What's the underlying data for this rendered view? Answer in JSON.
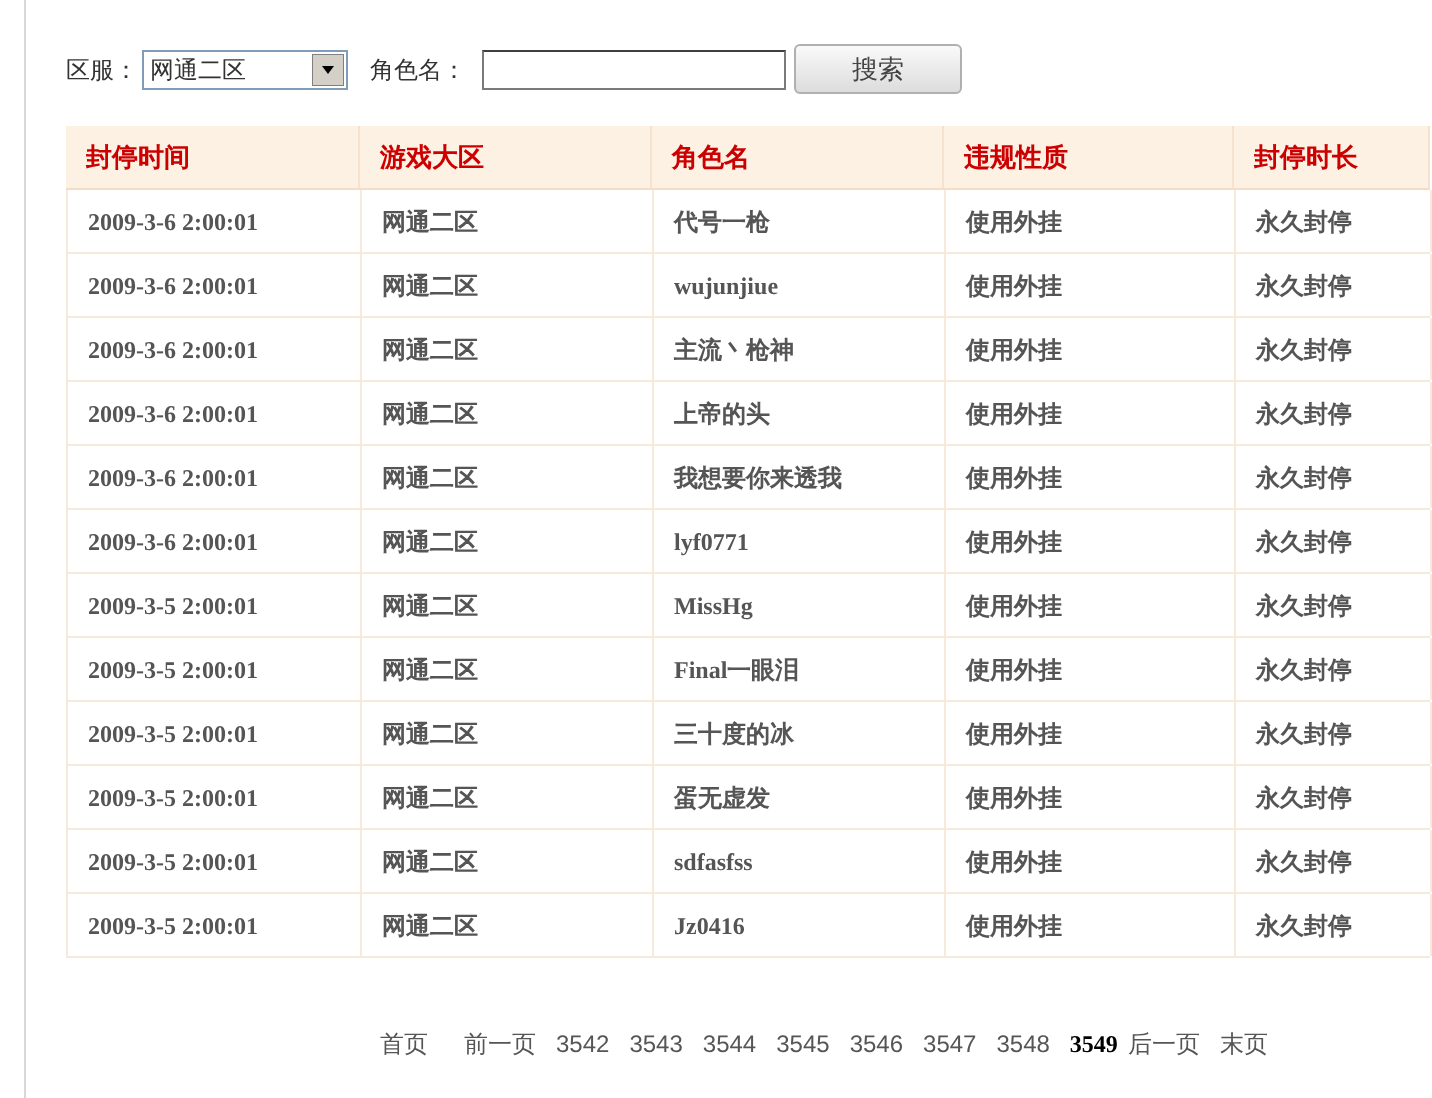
{
  "search": {
    "server_label": "区服：",
    "server_value": "网通二区",
    "name_label": "角色名：",
    "button": "搜索"
  },
  "table": {
    "columns": [
      "封停时间",
      "游戏大区",
      "角色名",
      "违规性质",
      "封停时长"
    ],
    "rows": [
      [
        "2009-3-6 2:00:01",
        "网通二区",
        "代号一枪",
        "使用外挂",
        "永久封停"
      ],
      [
        "2009-3-6 2:00:01",
        "网通二区",
        "wujunjiue",
        "使用外挂",
        "永久封停"
      ],
      [
        "2009-3-6 2:00:01",
        "网通二区",
        "主流丶枪神",
        "使用外挂",
        "永久封停"
      ],
      [
        "2009-3-6 2:00:01",
        "网通二区",
        "上帝的头",
        "使用外挂",
        "永久封停"
      ],
      [
        "2009-3-6 2:00:01",
        "网通二区",
        "我想要你来透我",
        "使用外挂",
        "永久封停"
      ],
      [
        "2009-3-6 2:00:01",
        "网通二区",
        "lyf0771",
        "使用外挂",
        "永久封停"
      ],
      [
        "2009-3-5 2:00:01",
        "网通二区",
        "MissHg",
        "使用外挂",
        "永久封停"
      ],
      [
        "2009-3-5 2:00:01",
        "网通二区",
        "Final一眼泪",
        "使用外挂",
        "永久封停"
      ],
      [
        "2009-3-5 2:00:01",
        "网通二区",
        "三十度的冰",
        "使用外挂",
        "永久封停"
      ],
      [
        "2009-3-5 2:00:01",
        "网通二区",
        "蛋无虚发",
        "使用外挂",
        "永久封停"
      ],
      [
        "2009-3-5 2:00:01",
        "网通二区",
        "sdfasfss",
        "使用外挂",
        "永久封停"
      ],
      [
        "2009-3-5 2:00:01",
        "网通二区",
        "Jz0416",
        "使用外挂",
        "永久封停"
      ]
    ]
  },
  "pagination": [
    {
      "label": "首页",
      "selected": false
    },
    {
      "label": "前一页",
      "selected": false
    },
    {
      "label": "3542",
      "selected": false
    },
    {
      "label": "3543",
      "selected": false
    },
    {
      "label": "3544",
      "selected": false
    },
    {
      "label": "3545",
      "selected": false
    },
    {
      "label": "3546",
      "selected": false
    },
    {
      "label": "3547",
      "selected": false
    },
    {
      "label": "3548",
      "selected": false
    },
    {
      "label": "3549",
      "selected": true
    },
    {
      "label": "后一页",
      "selected": false
    },
    {
      "label": "末页",
      "selected": false
    }
  ]
}
